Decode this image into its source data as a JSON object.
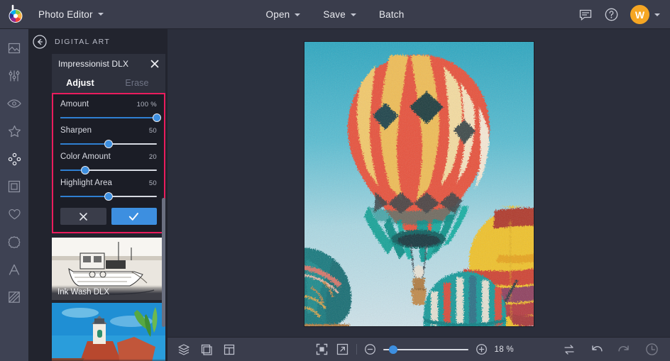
{
  "topbar": {
    "logo_icon": "bfree-color-wheel-logo",
    "app_menu_label": "Photo Editor",
    "app_menu_caret_icon": "chevron-down-icon",
    "center_buttons": [
      {
        "label": "Open",
        "has_caret": true,
        "icon": "chevron-down-icon"
      },
      {
        "label": "Save",
        "has_caret": true,
        "icon": "chevron-down-icon"
      },
      {
        "label": "Batch",
        "has_caret": false,
        "icon": ""
      }
    ],
    "right_icons": [
      {
        "name": "feedback-chat-icon"
      },
      {
        "name": "help-question-icon"
      }
    ],
    "avatar_initial": "W",
    "avatar_color": "#f5a623",
    "avatar_caret_icon": "chevron-down-icon"
  },
  "rail": {
    "items": [
      {
        "icon": "photo-image-icon",
        "active": false
      },
      {
        "icon": "sliders-adjust-icon",
        "active": false
      },
      {
        "icon": "eye-retouch-icon",
        "active": false
      },
      {
        "icon": "star-effects-icon",
        "active": false
      },
      {
        "icon": "digital-art-icon",
        "active": true
      },
      {
        "icon": "frame-border-icon",
        "active": false
      },
      {
        "icon": "heart-overlay-icon",
        "active": false
      },
      {
        "icon": "badge-sticker-icon",
        "active": false
      },
      {
        "icon": "text-type-icon",
        "active": false
      },
      {
        "icon": "texture-icon",
        "active": false
      }
    ]
  },
  "panel": {
    "back_icon": "back-arrow-circle-icon",
    "title": "DIGITAL ART",
    "effect": {
      "name": "Impressionist DLX",
      "close_icon": "close-x-icon",
      "tabs": [
        {
          "label": "Adjust",
          "active": true
        },
        {
          "label": "Erase",
          "active": false
        }
      ],
      "highlight_color": "#ea1c5d",
      "sliders": [
        {
          "name": "Amount",
          "value": "100 %",
          "pct": 100
        },
        {
          "name": "Sharpen",
          "value": "50",
          "pct": 50
        },
        {
          "name": "Color Amount",
          "value": "20",
          "pct": 26
        },
        {
          "name": "Highlight Area",
          "value": "50",
          "pct": 50
        }
      ],
      "cancel_icon": "close-x-icon",
      "apply_icon": "checkmark-icon"
    },
    "presets": [
      {
        "caption": "Ink Wash DLX",
        "thumb": "ink-wash-boat-thumbnail"
      },
      {
        "caption": "",
        "thumb": "lighthouse-painting-thumbnail"
      }
    ]
  },
  "canvas": {
    "image_alt": "impressionist-hot-air-balloons"
  },
  "bottombar": {
    "left_icons": [
      {
        "name": "layers-icon"
      },
      {
        "name": "crop-rotate-icon"
      },
      {
        "name": "layout-compare-icon"
      }
    ],
    "center_icons": [
      {
        "name": "fit-to-screen-icon"
      },
      {
        "name": "fullscreen-expand-icon"
      }
    ],
    "zoom_out_icon": "zoom-minus-icon",
    "zoom_in_icon": "zoom-plus-icon",
    "zoom_percent": "18 %",
    "zoom_slider_pct": 12,
    "right_icons": [
      {
        "name": "before-after-toggle-icon",
        "disabled": false
      },
      {
        "name": "undo-icon",
        "disabled": false
      },
      {
        "name": "redo-icon",
        "disabled": true
      },
      {
        "name": "history-clock-icon",
        "disabled": true
      }
    ]
  }
}
